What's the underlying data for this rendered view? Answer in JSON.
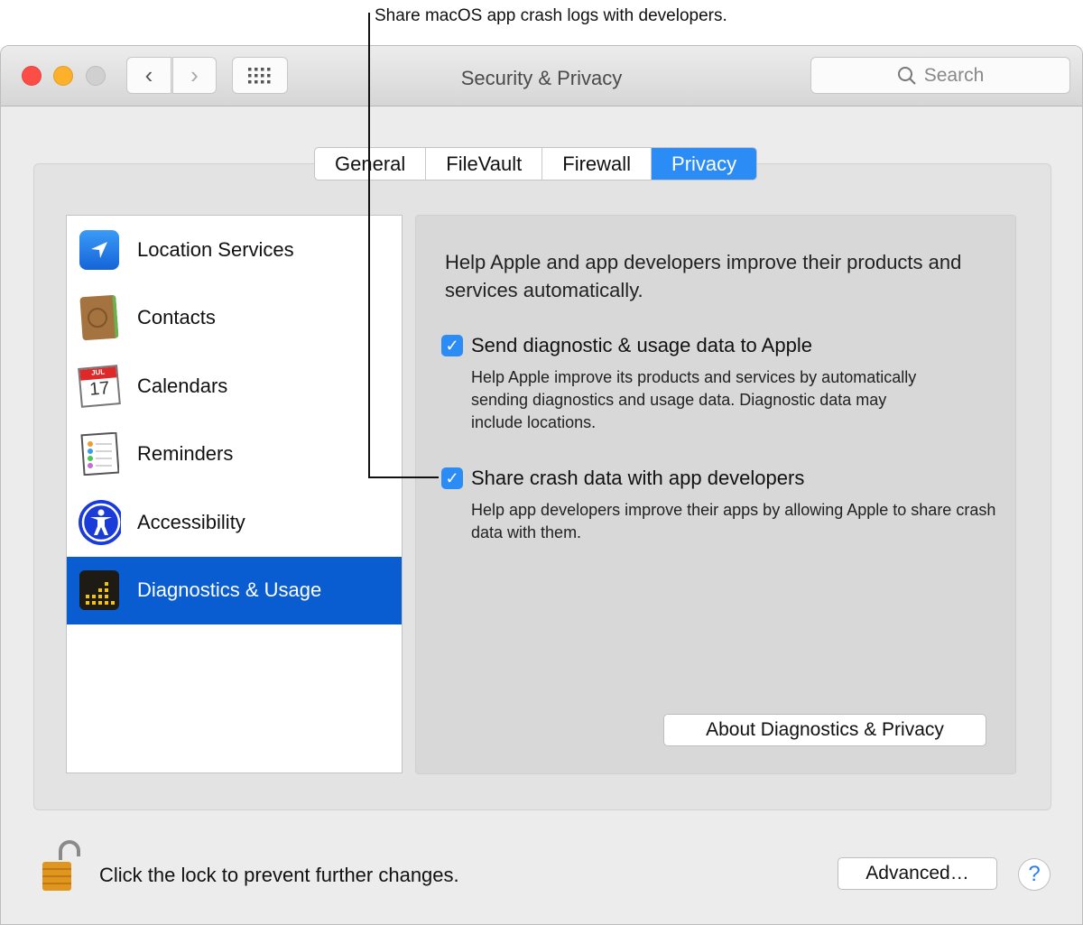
{
  "callout": "Share macOS app crash logs with developers.",
  "window": {
    "title": "Security & Privacy",
    "search_placeholder": "Search"
  },
  "tabs": [
    {
      "label": "General"
    },
    {
      "label": "FileVault"
    },
    {
      "label": "Firewall"
    },
    {
      "label": "Privacy",
      "active": true
    }
  ],
  "sidebar": {
    "items": [
      {
        "label": "Location Services"
      },
      {
        "label": "Contacts"
      },
      {
        "label": "Calendars",
        "icon_text": "JUL",
        "icon_day": "17"
      },
      {
        "label": "Reminders"
      },
      {
        "label": "Accessibility"
      },
      {
        "label": "Diagnostics & Usage",
        "selected": true
      }
    ]
  },
  "pane": {
    "intro": "Help Apple and app developers improve their products and services automatically.",
    "options": [
      {
        "label": "Send diagnostic & usage data to Apple",
        "checked": true,
        "desc": "Help Apple improve its products and services by automatically sending diagnostics and usage data. Diagnostic data may include locations."
      },
      {
        "label": "Share crash data with app developers",
        "checked": true,
        "desc": "Help app developers improve their apps by allowing Apple to share crash data with them."
      }
    ],
    "about_button": "About Diagnostics & Privacy"
  },
  "footer": {
    "lock_text": "Click the lock to prevent further changes.",
    "advanced_button": "Advanced…",
    "help": "?"
  },
  "colors": {
    "accent": "#2b8cf5",
    "selection": "#0a5dd0"
  }
}
